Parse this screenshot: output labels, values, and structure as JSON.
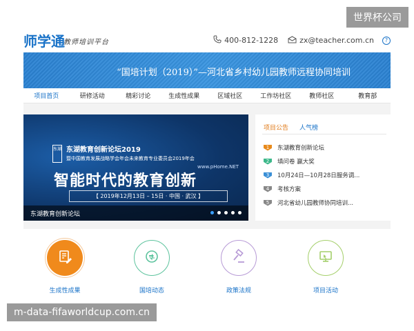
{
  "watermarks": {
    "top": "世界杯公司",
    "bottom": "m-data-fifaworldcup.com.cn"
  },
  "header": {
    "logo": "师学通",
    "slogan": "教师培训平台",
    "phone": "400-812-1228",
    "email": "zx@teacher.com.cn",
    "phone_icon": "phone-icon",
    "email_icon": "mail-icon",
    "help_icon": "help-icon"
  },
  "banner": {
    "title": "“国培计划（2019）”—河北省乡村幼儿园教师远程协同培训"
  },
  "nav": {
    "items": [
      "项目首页",
      "研修活动",
      "精彩讨论",
      "生成性成果",
      "区域社区",
      "工作坊社区",
      "教师社区",
      "教育部"
    ],
    "active_index": 0
  },
  "slider": {
    "badge": "东湖",
    "org_line1": "东湖教育创新论坛2019",
    "org_line2": "暨中国教育发展战略学会年会未来教育专业委员会2019年会",
    "site": "www.pHome.NET",
    "headline": "智能时代的教育创新",
    "date_line": "【 2019年12月13日 – 15日 · 中国 · 武汉 】",
    "caption": "东湖教育创新论坛",
    "slide_count": 5,
    "active_slide": 0
  },
  "panel": {
    "tabs": [
      "项目公告",
      "人气榜"
    ],
    "active_tab": 0,
    "items": [
      {
        "rank": "1",
        "text": "东湖教育创新论坛"
      },
      {
        "rank": "2",
        "text": "填问卷 赢大奖"
      },
      {
        "rank": "3",
        "text": "10月24日—10月28日服务调..."
      },
      {
        "rank": "4",
        "text": "考核方案"
      },
      {
        "rank": "5",
        "text": "河北省幼儿园教师协同培训..."
      }
    ]
  },
  "features": [
    {
      "label": "生成性成果",
      "icon": "document-edit-icon",
      "color": "#f08a1c"
    },
    {
      "label": "国培动态",
      "icon": "refresh-icon",
      "color": "#5cc39d"
    },
    {
      "label": "政策法规",
      "icon": "gavel-icon",
      "color": "#b79ad6"
    },
    {
      "label": "项目活动",
      "icon": "monitor-icon",
      "color": "#a4cf6a"
    }
  ]
}
